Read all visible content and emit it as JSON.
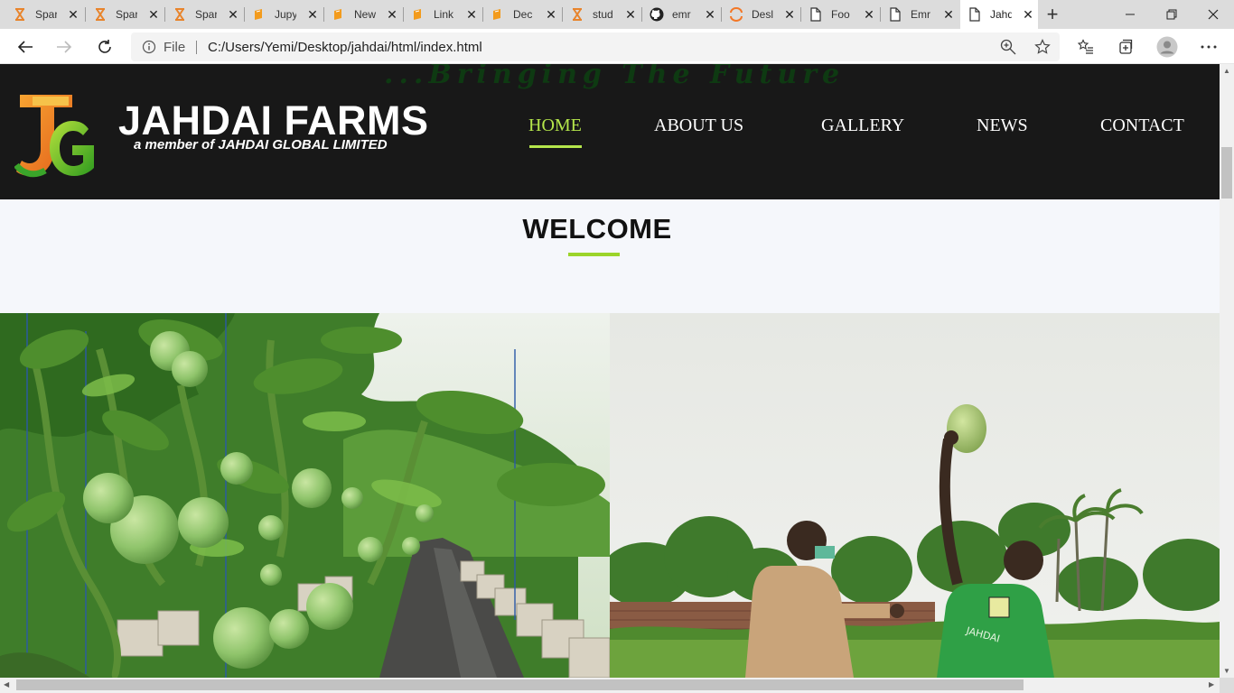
{
  "browser": {
    "tabs": [
      {
        "title": "Spar",
        "icon": "hourglass-icon",
        "active": false
      },
      {
        "title": "Spar",
        "icon": "hourglass-icon",
        "active": false
      },
      {
        "title": "Spar",
        "icon": "hourglass-icon",
        "active": false
      },
      {
        "title": "Jupy",
        "icon": "book-icon",
        "active": false
      },
      {
        "title": "New",
        "icon": "book-icon",
        "active": false
      },
      {
        "title": "Link",
        "icon": "book-icon",
        "active": false
      },
      {
        "title": "Dec",
        "icon": "book-icon",
        "active": false
      },
      {
        "title": "stud",
        "icon": "hourglass-icon",
        "active": false
      },
      {
        "title": "emr",
        "icon": "github-icon",
        "active": false
      },
      {
        "title": "Desl",
        "icon": "loading-icon",
        "active": false
      },
      {
        "title": "Foo",
        "icon": "document-icon",
        "active": false
      },
      {
        "title": "Emr",
        "icon": "document-icon",
        "active": false
      },
      {
        "title": "Jahd",
        "icon": "document-icon",
        "active": true
      }
    ],
    "address": {
      "scheme_label": "File",
      "url": "C:/Users/Yemi/Desktop/jahdai/html/index.html"
    }
  },
  "site": {
    "bg_script_text": "...Bringing The Future",
    "brand": {
      "name": "JAHDAI FARMS",
      "tagline": "a member of JAHDAI GLOBAL LIMITED"
    },
    "nav": [
      {
        "label": "HOME",
        "active": true
      },
      {
        "label": "ABOUT US",
        "active": false
      },
      {
        "label": "GALLERY",
        "active": false
      },
      {
        "label": "NEWS",
        "active": false
      },
      {
        "label": "CONTACT",
        "active": false
      }
    ],
    "welcome": {
      "title": "WELCOME"
    },
    "photos": [
      {
        "subject": "tomato-greenhouse-photo"
      },
      {
        "subject": "watermelon-toss-photo",
        "shirt_text": "JAHDAI"
      }
    ]
  },
  "colors": {
    "header_bg": "#181818",
    "accent_green": "#b5e64b",
    "page_bg": "#f5f7fb"
  }
}
